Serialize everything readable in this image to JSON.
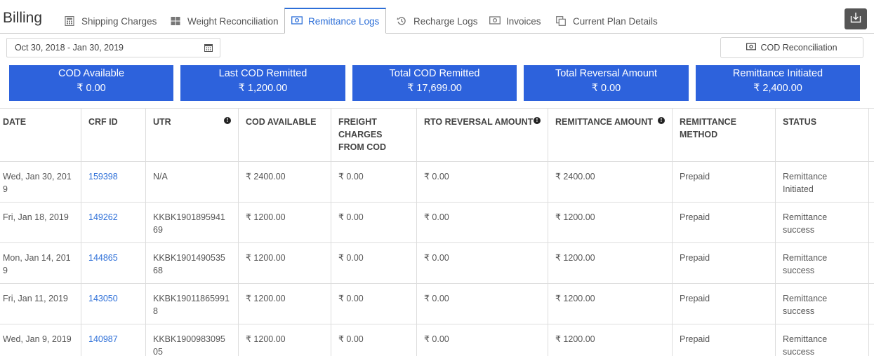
{
  "header": {
    "title": "Billing",
    "tabs": [
      {
        "label": "Shipping Charges",
        "icon": "calculator-icon"
      },
      {
        "label": "Weight Reconciliation",
        "icon": "grid-icon"
      },
      {
        "label": "Remittance Logs",
        "icon": "money-icon",
        "active": true
      },
      {
        "label": "Recharge Logs",
        "icon": "history-icon"
      },
      {
        "label": "Invoices",
        "icon": "money-icon"
      },
      {
        "label": "Current Plan Details",
        "icon": "copy-icon"
      }
    ],
    "export_icon": "download-icon"
  },
  "toolbar": {
    "date_range": "Oct 30, 2018 - Jan 30, 2019",
    "cod_reconciliation_label": "COD Reconciliation"
  },
  "cards": [
    {
      "label": "COD Available",
      "value": "₹ 0.00"
    },
    {
      "label": "Last COD Remitted",
      "value": "₹ 1,200.00"
    },
    {
      "label": "Total COD Remitted",
      "value": "₹ 17,699.00"
    },
    {
      "label": "Total Reversal Amount",
      "value": "₹ 0.00"
    },
    {
      "label": "Remittance Initiated",
      "value": "₹ 2,400.00"
    }
  ],
  "table": {
    "headers": [
      "DATE",
      "CRF ID",
      "UTR",
      "COD AVAILABLE",
      "FREIGHT CHARGES FROM COD",
      "RTO REVERSAL AMOUNT",
      "REMITTANCE AMOUNT",
      "REMITTANCE METHOD",
      "STATUS"
    ],
    "rows": [
      [
        "Wed, Jan 30, 2019",
        "159398",
        "N/A",
        "₹ 2400.00",
        "₹ 0.00",
        "₹ 0.00",
        "₹ 2400.00",
        "Prepaid",
        "Remittance Initiated"
      ],
      [
        "Fri, Jan 18, 2019",
        "149262",
        "KKBK190189594169",
        "₹ 1200.00",
        "₹ 0.00",
        "₹ 0.00",
        "₹ 1200.00",
        "Prepaid",
        "Remittance success"
      ],
      [
        "Mon, Jan 14, 2019",
        "144865",
        "KKBK190149053568",
        "₹ 1200.00",
        "₹ 0.00",
        "₹ 0.00",
        "₹ 1200.00",
        "Prepaid",
        "Remittance success"
      ],
      [
        "Fri, Jan 11, 2019",
        "143050",
        "KKBK190118659918",
        "₹ 1200.00",
        "₹ 0.00",
        "₹ 0.00",
        "₹ 1200.00",
        "Prepaid",
        "Remittance success"
      ],
      [
        "Wed, Jan 9, 2019",
        "140987",
        "KKBK190098309505",
        "₹ 1200.00",
        "₹ 0.00",
        "₹ 0.00",
        "₹ 1200.00",
        "Prepaid",
        "Remittance success"
      ]
    ]
  },
  "colors": {
    "accent": "#2d6fd8",
    "card_bg": "#2d62dc",
    "export_bg": "#555555"
  }
}
